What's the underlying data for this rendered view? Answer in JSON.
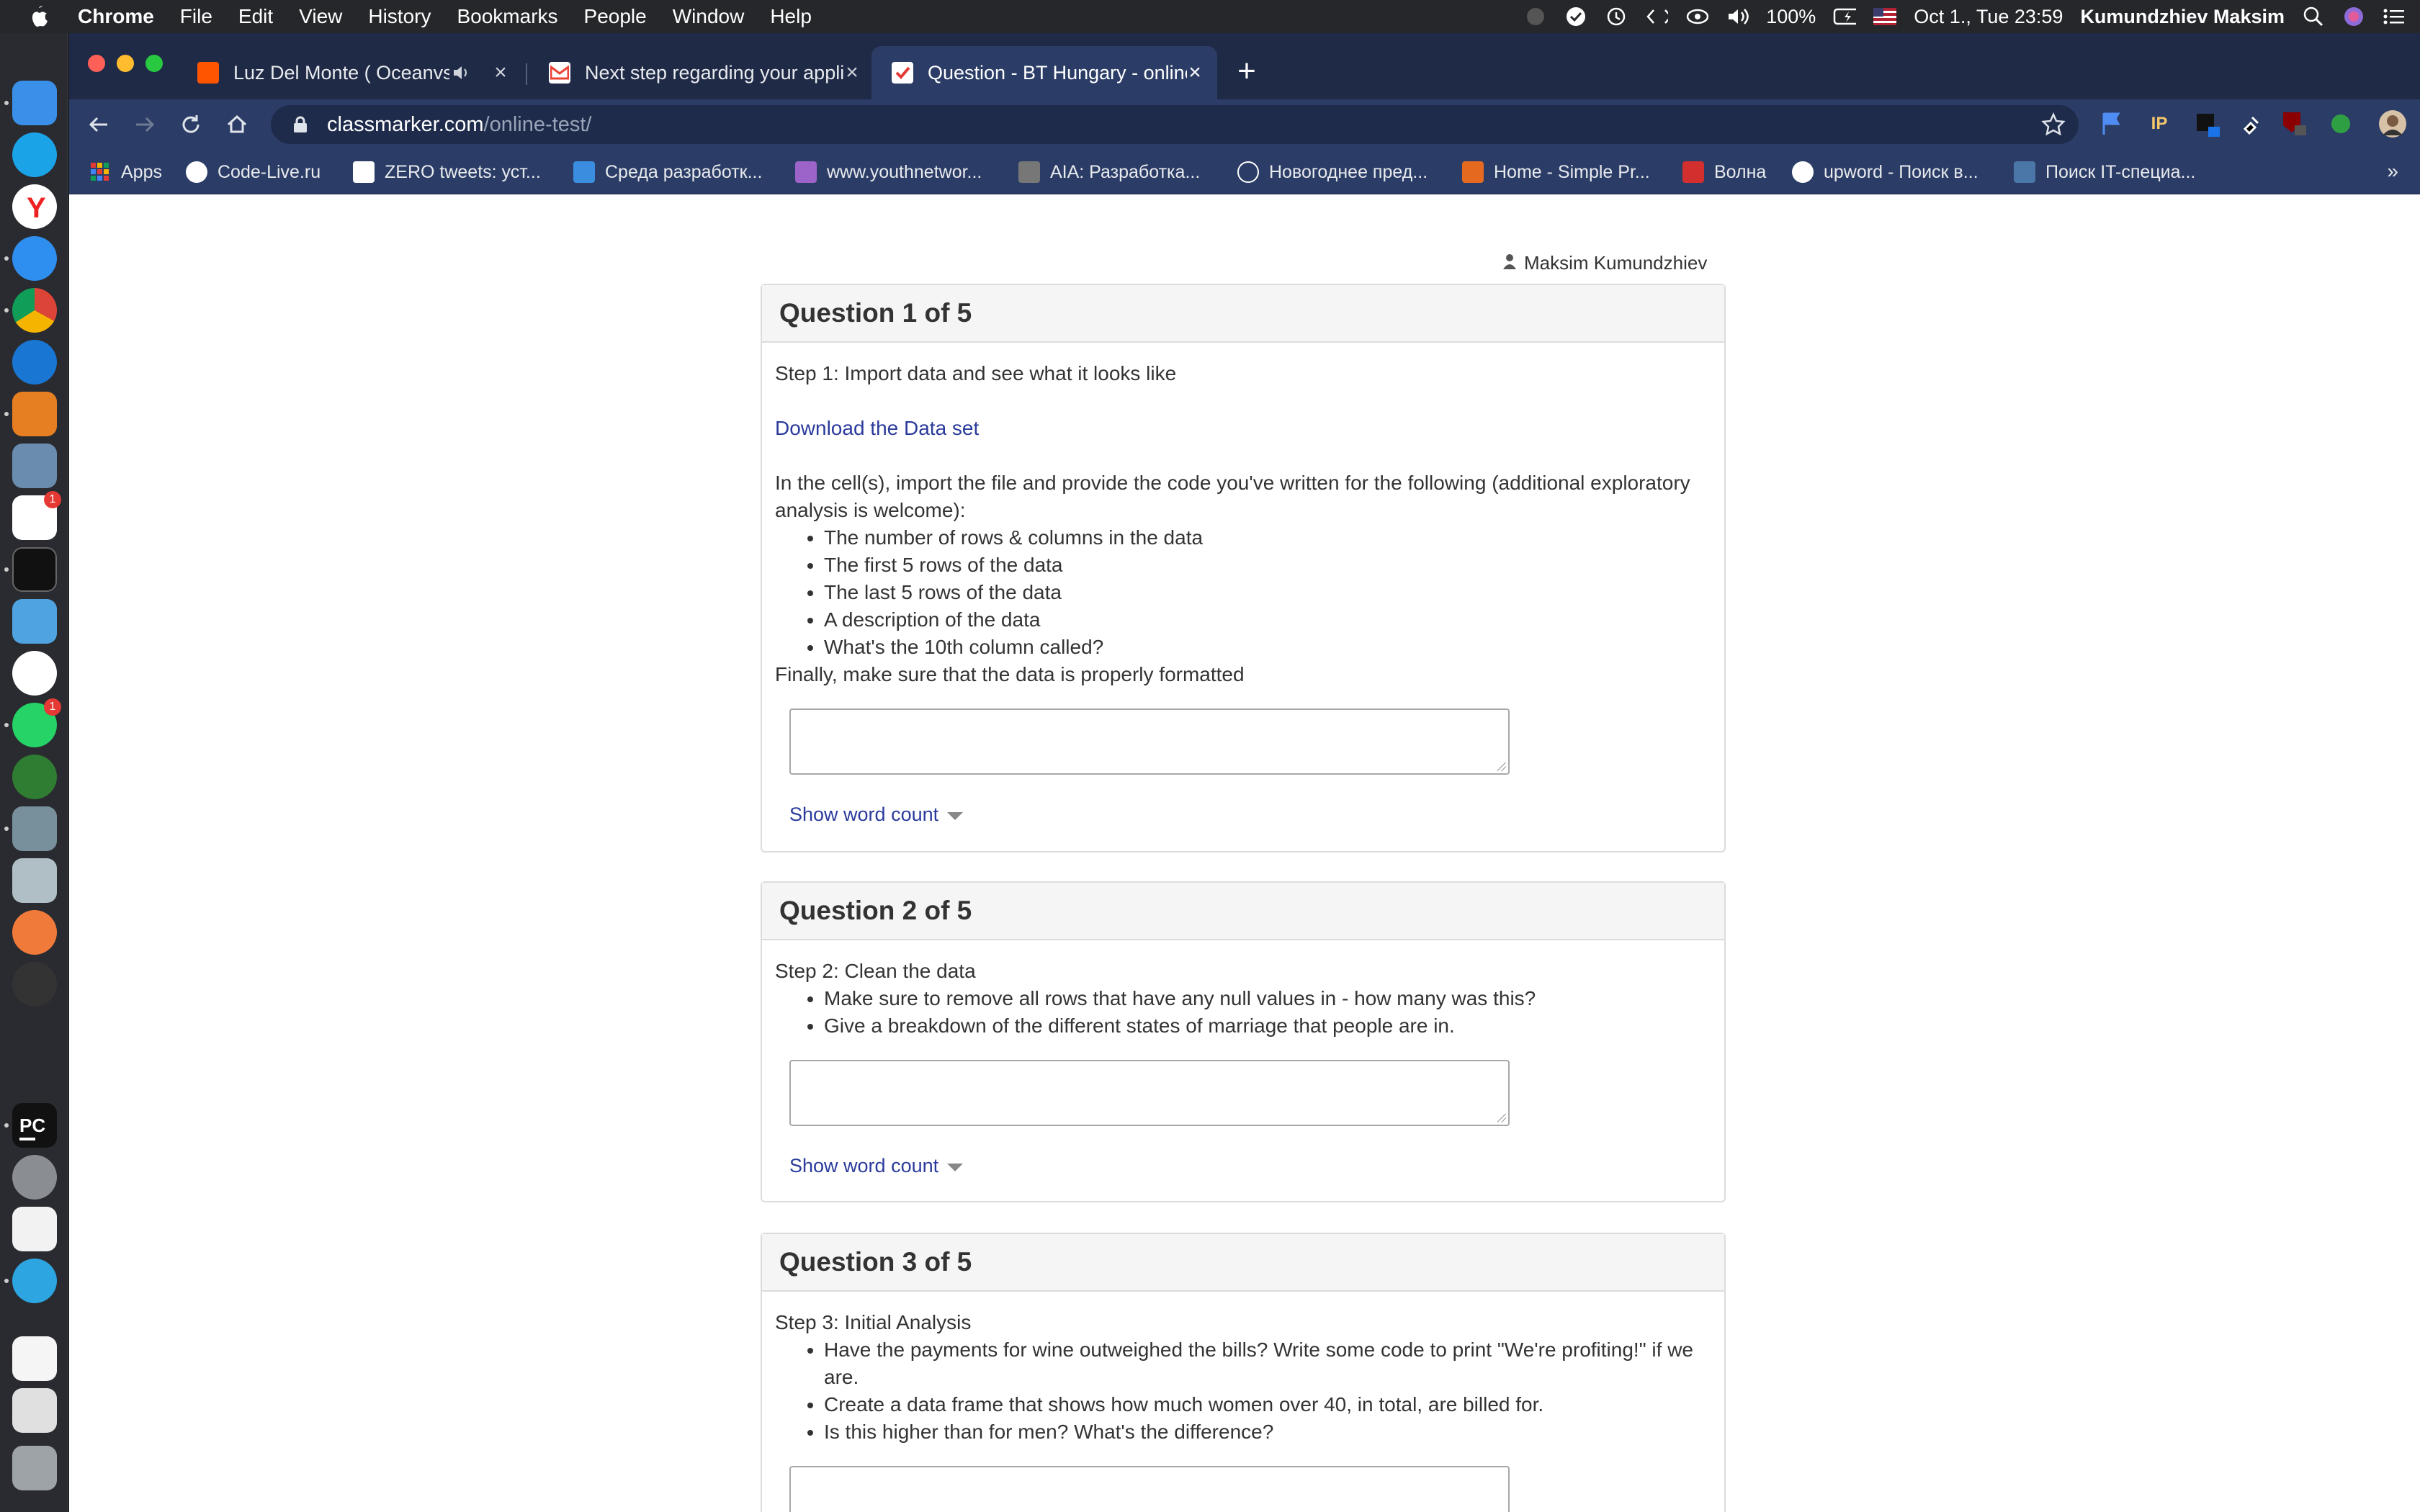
{
  "menubar": {
    "app": "Chrome",
    "items": [
      "File",
      "Edit",
      "View",
      "History",
      "Bookmarks",
      "People",
      "Window",
      "Help"
    ],
    "battery": "100%",
    "datetime": "Oct 1., Tue  23:59",
    "user": "Kumundzhiev Maksim"
  },
  "tabs": [
    {
      "title": "Luz Del Monte ( Oceanvs O",
      "favicon": "soundcloud-icon",
      "color": "#ff5500"
    },
    {
      "title": "Next step regarding your applic",
      "favicon": "gmail-icon",
      "color": "#ea4335"
    },
    {
      "title": "Question - BT Hungary - online",
      "favicon": "classmarker-icon",
      "color": "#e53935"
    }
  ],
  "address": {
    "host": "classmarker.com",
    "path": "/online-test/"
  },
  "bookmarks": [
    {
      "label": "Apps",
      "icon": "apps-grid-icon",
      "color": "#4285f4"
    },
    {
      "label": "Code-Live.ru",
      "icon": "code-live-icon",
      "color": "#ffffff"
    },
    {
      "label": "ZERO tweets: уст...",
      "icon": "zero-tweets-icon",
      "color": "#ffffff"
    },
    {
      "label": "Среда разработк...",
      "icon": "chart-icon",
      "color": "#3b8de0"
    },
    {
      "label": "www.youthnetwor...",
      "icon": "youthnetwork-icon",
      "color": "#9c64c8"
    },
    {
      "label": "AIA: Разработка...",
      "icon": "gt-icon",
      "color": "#777777"
    },
    {
      "label": "Новогоднее пред...",
      "icon": "openai-icon",
      "color": "#ffffff"
    },
    {
      "label": "Home - Simple Pr...",
      "icon": "sp-icon",
      "color": "#e56a1f"
    },
    {
      "label": "Волна",
      "icon": "volna-icon",
      "color": "#d32f2f"
    },
    {
      "label": "upword - Поиск в...",
      "icon": "google-icon",
      "color": "#ffffff"
    },
    {
      "label": "Поиск IT-специа...",
      "icon": "vk-icon",
      "color": "#4a76a8"
    }
  ],
  "page": {
    "user_name": "Maksim Kumundzhiev",
    "word_count_label": "Show word count",
    "questions": [
      {
        "heading": "Question 1 of 5",
        "intro": "Step 1: Import data and see what it looks like",
        "link": "Download the Data set",
        "body": "In the cell(s), import the file and provide the code you've written for the following (additional exploratory analysis is welcome):",
        "bullets": [
          "The number of rows & columns in the data",
          "The first 5 rows of the data",
          "The last 5 rows of the data",
          "A description of the data",
          "What's the 10th column called?"
        ],
        "outro": "Finally, make sure that the data is properly formatted"
      },
      {
        "heading": "Question 2 of 5",
        "intro": "Step 2: Clean the data",
        "bullets": [
          "Make sure to remove all rows that have any null values in - how many was this?",
          "Give a breakdown of the different states of marriage that people are in."
        ]
      },
      {
        "heading": "Question 3 of 5",
        "intro": "Step 3: Initial Analysis",
        "bullets": [
          "Have the payments for wine outweighed the bills? Write some code to print \"We're profiting!\" if we are.",
          "Create a data frame that shows how much women over 40, in total, are billed for.",
          "Is this higher than for men? What's the difference?"
        ]
      }
    ]
  }
}
